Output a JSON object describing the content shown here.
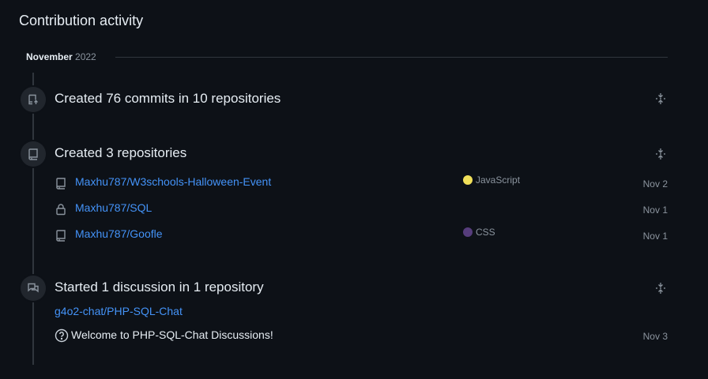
{
  "header": {
    "title": "Contribution activity"
  },
  "period": {
    "month": "November",
    "year": "2022"
  },
  "commits": {
    "summary": "Created 76 commits in 10 repositories"
  },
  "repositories": {
    "summary": "Created 3 repositories",
    "items": [
      {
        "name": "Maxhu787/W3schools-Halloween-Event",
        "language": "JavaScript",
        "language_color": "#f1e05a",
        "date": "Nov 2",
        "icon": "repo-icon"
      },
      {
        "name": "Maxhu787/SQL",
        "language": "",
        "language_color": "",
        "date": "Nov 1",
        "icon": "lock-icon"
      },
      {
        "name": "Maxhu787/Goofle",
        "language": "CSS",
        "language_color": "#563d7c",
        "date": "Nov 1",
        "icon": "repo-icon"
      }
    ]
  },
  "discussions": {
    "summary": "Started 1 discussion in 1 repository",
    "repo": "g4o2-chat/PHP-SQL-Chat",
    "item": {
      "title": "Welcome to PHP-SQL-Chat Discussions!",
      "date": "Nov 3",
      "icon": "question-circle-icon"
    }
  },
  "colors": {
    "background": "#0d1117",
    "link": "#4493f8",
    "muted": "#8b949e",
    "border": "#30363d"
  }
}
